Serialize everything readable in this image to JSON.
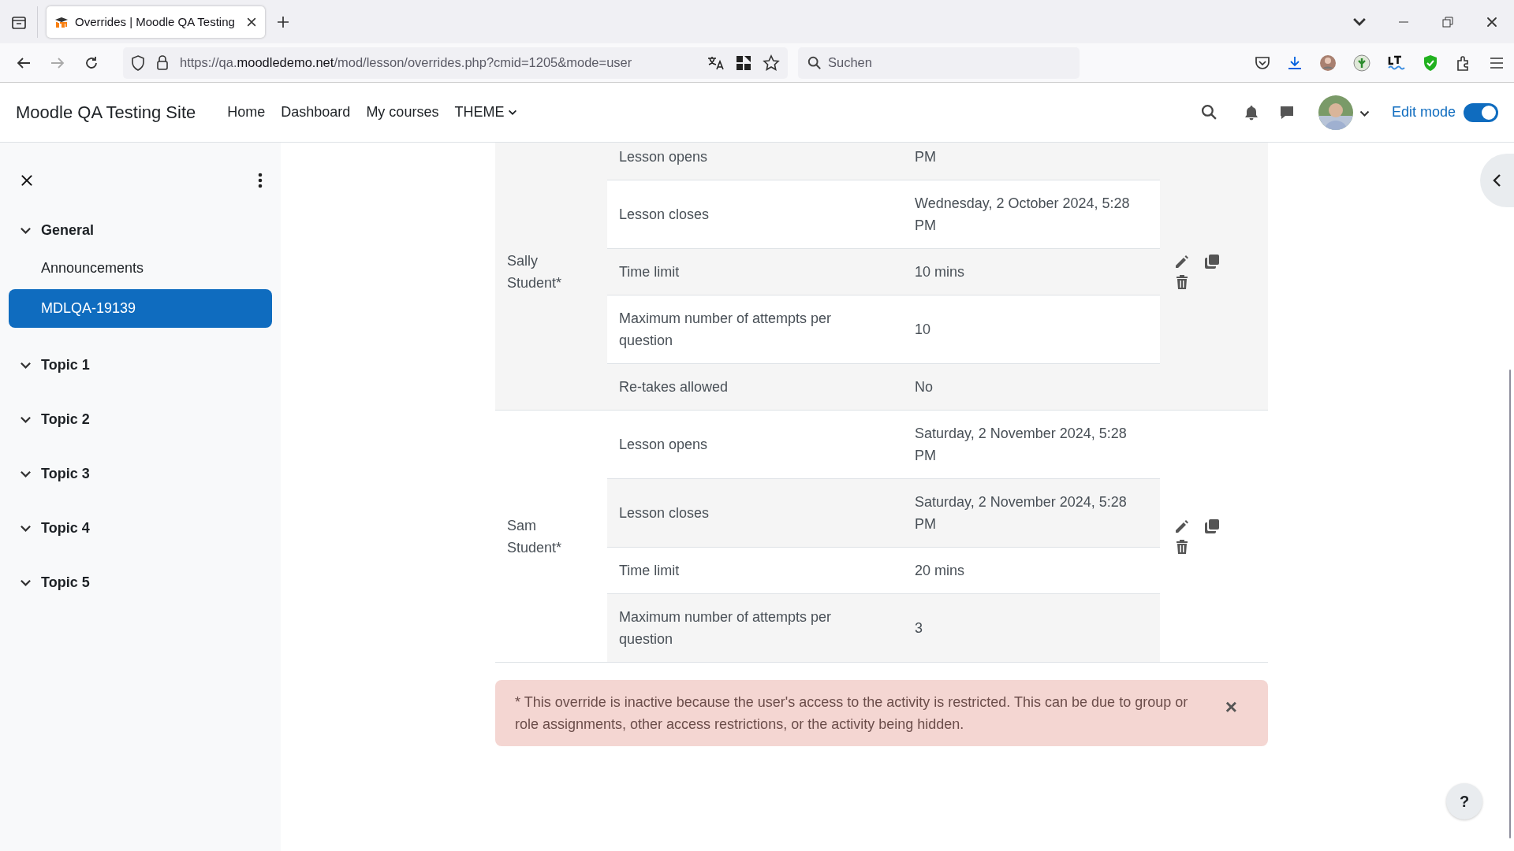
{
  "browser": {
    "tab": {
      "title": "Overrides | Moodle QA Testing"
    },
    "address": "https://qa.moodledemo.net/mod/lesson/overrides.php?cmid=1205&mode=user",
    "search": {
      "placeholder": "Suchen"
    }
  },
  "navbar": {
    "site_name": "Moodle QA Testing Site",
    "links": [
      {
        "label": "Home",
        "kind": "link"
      },
      {
        "label": "Dashboard",
        "kind": "link"
      },
      {
        "label": "My courses",
        "kind": "link"
      },
      {
        "label": "THEME",
        "kind": "dropdown"
      }
    ],
    "edit_mode": {
      "label": "Edit mode",
      "on": true
    }
  },
  "course_index": {
    "items": [
      {
        "label": "General",
        "expanded": true,
        "selected": false,
        "children": [
          {
            "label": "Announcements",
            "selected": false
          },
          {
            "label": "MDLQA-19139",
            "selected": true
          }
        ]
      },
      {
        "label": "Topic 1",
        "expanded": true,
        "selected": false
      },
      {
        "label": "Topic 2",
        "expanded": true,
        "selected": false
      },
      {
        "label": "Topic 3",
        "expanded": true,
        "selected": false
      },
      {
        "label": "Topic 4",
        "expanded": true,
        "selected": false
      },
      {
        "label": "Topic 5",
        "expanded": true,
        "selected": false
      }
    ]
  },
  "overrides": [
    {
      "user": "Sally Student*",
      "settings": [
        {
          "setting": "Lesson opens",
          "value": "PM"
        },
        {
          "setting": "Lesson closes",
          "value": "Wednesday, 2 October 2024, 5:28 PM"
        },
        {
          "setting": "Time limit",
          "value": "10 mins"
        },
        {
          "setting": "Maximum number of attempts per question",
          "value": "10"
        },
        {
          "setting": "Re-takes allowed",
          "value": "No"
        }
      ]
    },
    {
      "user": "Sam Student*",
      "settings": [
        {
          "setting": "Lesson opens",
          "value": "Saturday, 2 November 2024, 5:28 PM"
        },
        {
          "setting": "Lesson closes",
          "value": "Saturday, 2 November 2024, 5:28 PM"
        },
        {
          "setting": "Time limit",
          "value": "20 mins"
        },
        {
          "setting": "Maximum number of attempts per question",
          "value": "3"
        }
      ]
    }
  ],
  "alert": {
    "text": "* This override is inactive because the user's access to the activity is restricted. This can be due to group or role assignments, other access restrictions, or the activity being hidden.",
    "dismiss": "×"
  },
  "help": {
    "label": "?"
  }
}
